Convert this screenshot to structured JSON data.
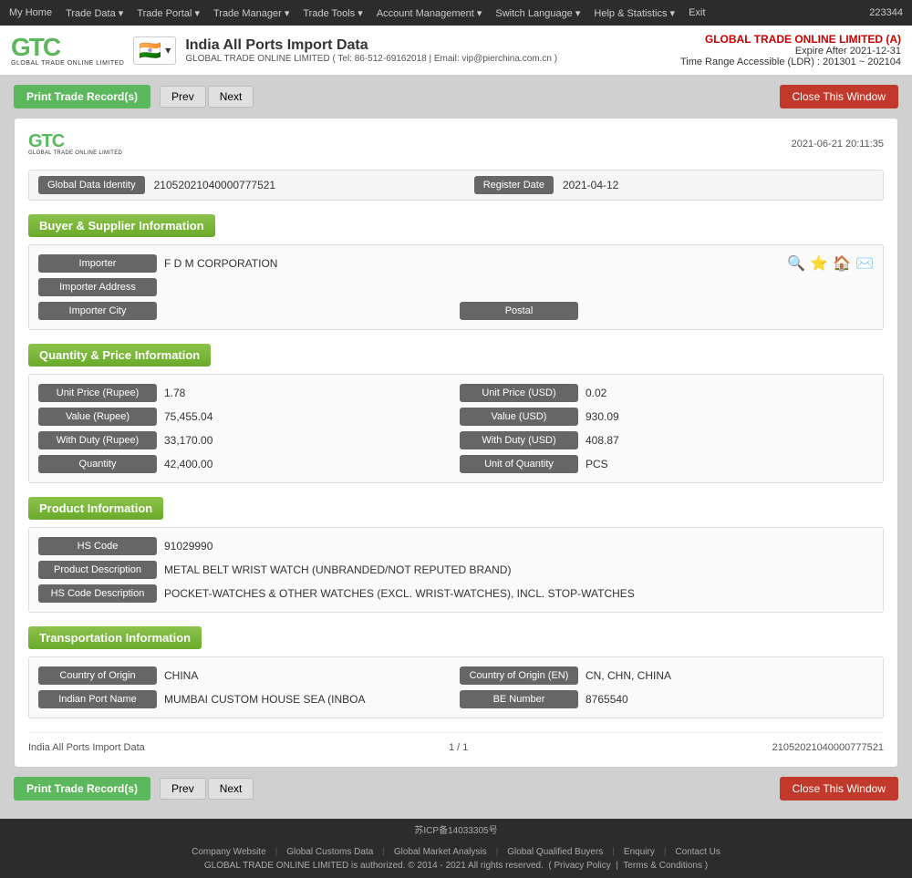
{
  "topNav": {
    "items": [
      "My Home",
      "Trade Data",
      "Trade Portal",
      "Trade Manager",
      "Trade Tools",
      "Account Management",
      "Switch Language",
      "Help & Statistics",
      "Exit"
    ],
    "user_id": "223344"
  },
  "header": {
    "title": "India All Ports Import Data",
    "subtitle": "GLOBAL TRADE ONLINE LIMITED ( Tel: 86-512-69162018 | Email: vip@pierchina.com.cn )",
    "company_name": "GLOBAL TRADE ONLINE LIMITED (A)",
    "expire": "Expire After 2021-12-31",
    "time_range": "Time Range Accessible (LDR) : 201301 ~ 202104"
  },
  "toolbar": {
    "print_label": "Print Trade Record(s)",
    "prev_label": "Prev",
    "next_label": "Next",
    "close_label": "Close This Window"
  },
  "record": {
    "datetime": "2021-06-21 20:11:35",
    "global_data_identity_label": "Global Data Identity",
    "global_data_identity_value": "21052021040000777521",
    "register_date_label": "Register Date",
    "register_date_value": "2021-04-12",
    "sections": {
      "buyer_supplier": {
        "title": "Buyer & Supplier Information",
        "fields": [
          {
            "label": "Importer",
            "value": "F D M CORPORATION",
            "full_width": true
          },
          {
            "label": "Importer Address",
            "value": "",
            "full_width": true
          },
          {
            "label": "Importer City",
            "value": "",
            "pair_label": "Postal",
            "pair_value": ""
          }
        ]
      },
      "quantity_price": {
        "title": "Quantity & Price Information",
        "rows": [
          [
            {
              "label": "Unit Price (Rupee)",
              "value": "1.78"
            },
            {
              "label": "Unit Price (USD)",
              "value": "0.02"
            }
          ],
          [
            {
              "label": "Value (Rupee)",
              "value": "75,455.04"
            },
            {
              "label": "Value (USD)",
              "value": "930.09"
            }
          ],
          [
            {
              "label": "With Duty (Rupee)",
              "value": "33,170.00"
            },
            {
              "label": "With Duty (USD)",
              "value": "408.87"
            }
          ],
          [
            {
              "label": "Quantity",
              "value": "42,400.00"
            },
            {
              "label": "Unit of Quantity",
              "value": "PCS"
            }
          ]
        ]
      },
      "product": {
        "title": "Product Information",
        "fields": [
          {
            "label": "HS Code",
            "value": "91029990"
          },
          {
            "label": "Product Description",
            "value": "METAL BELT WRIST WATCH (UNBRANDED/NOT REPUTED BRAND)"
          },
          {
            "label": "HS Code Description",
            "value": "POCKET-WATCHES & OTHER WATCHES (EXCL. WRIST-WATCHES), INCL. STOP-WATCHES"
          }
        ]
      },
      "transportation": {
        "title": "Transportation Information",
        "rows": [
          [
            {
              "label": "Country of Origin",
              "value": "CHINA"
            },
            {
              "label": "Country of Origin (EN)",
              "value": "CN, CHN, CHINA"
            }
          ],
          [
            {
              "label": "Indian Port Name",
              "value": "MUMBAI CUSTOM HOUSE SEA (INBOA"
            },
            {
              "label": "BE Number",
              "value": "8765540"
            }
          ]
        ]
      }
    },
    "footer": {
      "source": "India All Ports Import Data",
      "page": "1 / 1",
      "record_id": "21052021040000777521"
    }
  },
  "pageFooter": {
    "links": [
      "Company Website",
      "Global Customs Data",
      "Global Market Analysis",
      "Global Qualified Buyers",
      "Enquiry",
      "Contact Us"
    ],
    "copyright": "GLOBAL TRADE ONLINE LIMITED is authorized. © 2014 - 2021 All rights reserved.",
    "privacy": "Privacy Policy",
    "terms": "Terms & Conditions",
    "icp": "苏ICP备14033305号"
  }
}
